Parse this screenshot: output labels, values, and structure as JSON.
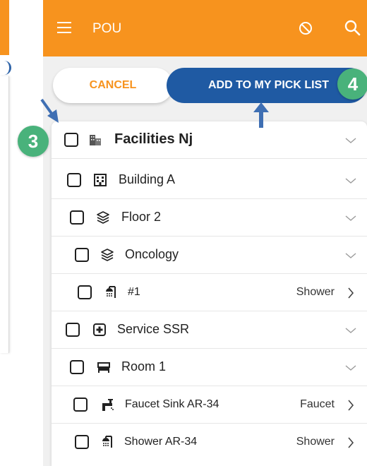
{
  "appbar": {
    "title": "POU",
    "menu_icon": "menu-icon",
    "block_icon": "block-icon",
    "search_icon": "search-icon"
  },
  "actions": {
    "cancel_label": "CANCEL",
    "add_label": "ADD TO MY PICK LIST"
  },
  "tree": [
    {
      "label": "Facilities Nj",
      "icon": "building-icon",
      "type": "",
      "chevron": "down"
    },
    {
      "label": "Building A",
      "icon": "building-grid-icon",
      "type": "",
      "chevron": "down"
    },
    {
      "label": "Floor 2",
      "icon": "layers-icon",
      "type": "",
      "chevron": "down"
    },
    {
      "label": "Oncology",
      "icon": "layers-icon",
      "type": "",
      "chevron": "down"
    },
    {
      "label": "#1",
      "icon": "shower-icon",
      "type": "Shower",
      "chevron": "right"
    },
    {
      "label": "Service SSR",
      "icon": "plus-square-icon",
      "type": "",
      "chevron": "down"
    },
    {
      "label": "Room 1",
      "icon": "bed-icon",
      "type": "",
      "chevron": "down"
    },
    {
      "label": "Faucet Sink AR-34",
      "icon": "faucet-icon",
      "type": "Faucet",
      "chevron": "right"
    },
    {
      "label": "Shower AR-34",
      "icon": "shower-icon",
      "type": "Shower",
      "chevron": "right"
    }
  ],
  "annotations": {
    "step3": "3",
    "step4": "4"
  },
  "colors": {
    "brand_orange": "#f7931e",
    "primary_blue": "#1f5aa3",
    "step_green": "#49b27b",
    "arrow_blue": "#3f6fb3"
  }
}
